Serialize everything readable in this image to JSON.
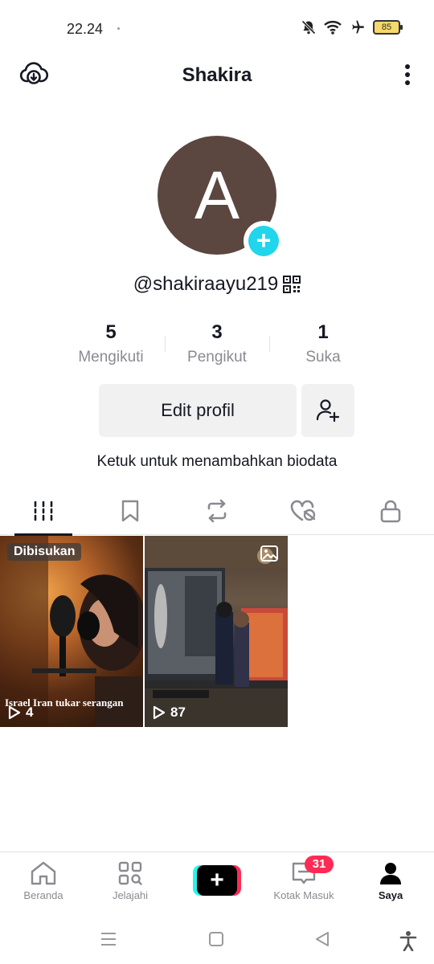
{
  "status_bar": {
    "time": "22.24",
    "battery": "85",
    "icons": [
      "bell-off-icon",
      "wifi-icon",
      "airplane-icon",
      "battery-icon"
    ]
  },
  "header": {
    "title": "Shakira",
    "left_icon": "cloud-download-icon",
    "right_icon": "more-vertical-icon"
  },
  "profile": {
    "avatar_letter": "A",
    "avatar_color": "#5b4740",
    "username": "@shakiraayu219",
    "stats": [
      {
        "value": "5",
        "label": "Mengikuti"
      },
      {
        "value": "3",
        "label": "Pengikut"
      },
      {
        "value": "1",
        "label": "Suka"
      }
    ],
    "edit_button": "Edit profil",
    "bio_placeholder": "Ketuk untuk menambahkan biodata"
  },
  "tabs": [
    {
      "icon": "grid-icon",
      "active": true
    },
    {
      "icon": "bookmark-icon",
      "active": false
    },
    {
      "icon": "repost-icon",
      "active": false
    },
    {
      "icon": "liked-hidden-icon",
      "active": false
    },
    {
      "icon": "lock-icon",
      "active": false
    }
  ],
  "videos": [
    {
      "badge": "Dibisukan",
      "caption": "Israel Iran tukar serangan",
      "views": "4"
    },
    {
      "views": "87",
      "type_icon": "photo-icon"
    }
  ],
  "bottom_nav": {
    "items": [
      {
        "label": "Beranda",
        "icon": "home-icon"
      },
      {
        "label": "Jelajahi",
        "icon": "explore-icon"
      },
      {
        "label": "",
        "icon": "plus-icon"
      },
      {
        "label": "Kotak Masuk",
        "icon": "inbox-icon",
        "badge": "31"
      },
      {
        "label": "Saya",
        "icon": "profile-icon",
        "active": true
      }
    ]
  },
  "colors": {
    "accent_cyan": "#20d5ec",
    "accent_red": "#fe2c55",
    "text_primary": "#161823",
    "text_secondary": "#8a8b91"
  }
}
